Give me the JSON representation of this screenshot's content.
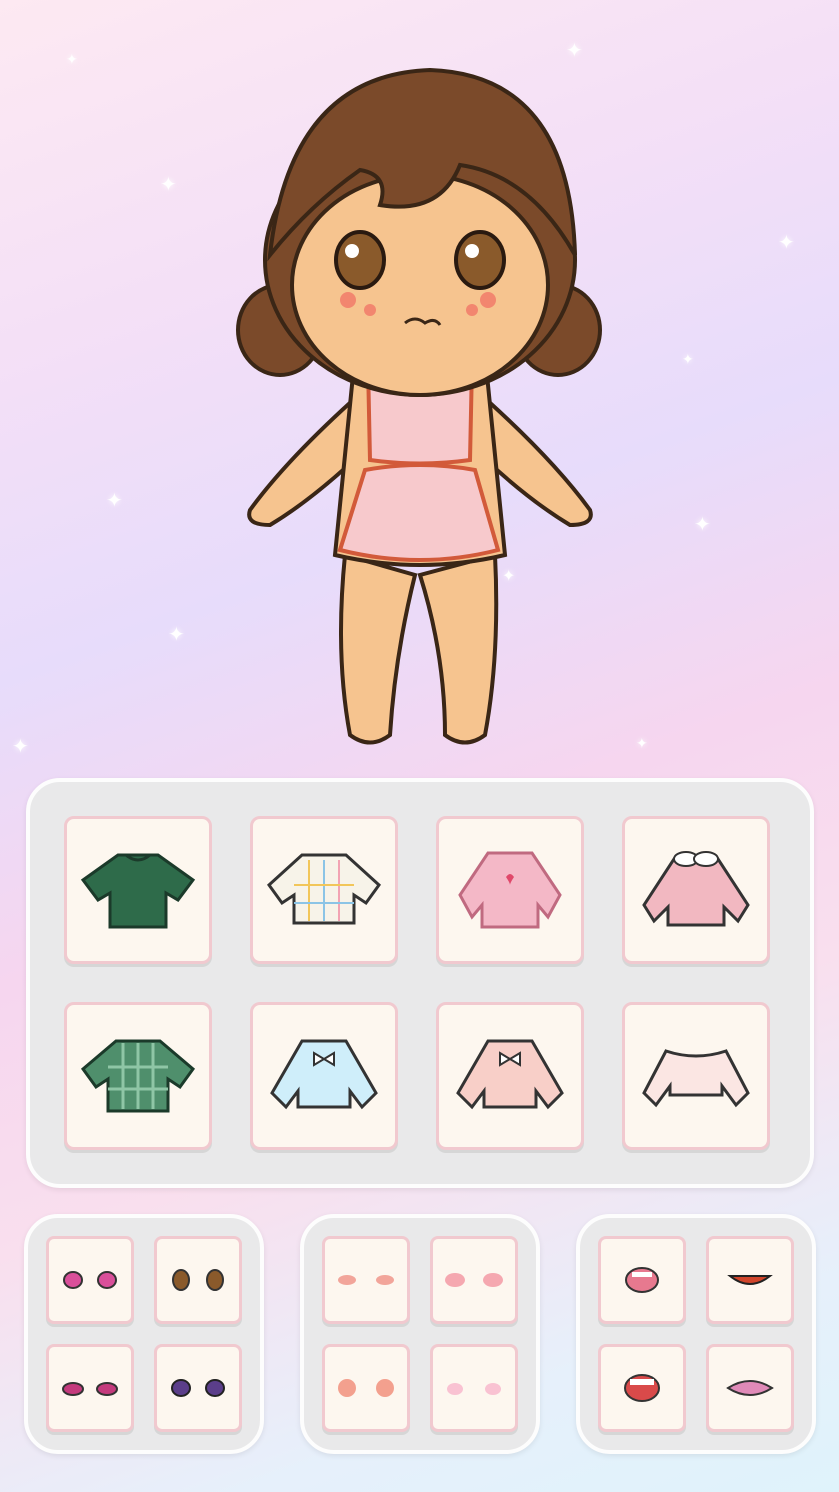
{
  "game": {
    "screen": "dress-up",
    "character": {
      "hair_color": "#7b4a2a",
      "skin_color": "#f6c48f",
      "outfit_color": "#f7c9cc",
      "outline_color": "#d25a3a"
    },
    "tops": [
      {
        "icon": "green-tshirt-icon",
        "color": "#2e6b4a"
      },
      {
        "icon": "plaid-white-top-icon",
        "color": "#f7f3e9"
      },
      {
        "icon": "pink-heart-sweater-icon",
        "color": "#f4b8c7"
      },
      {
        "icon": "pink-collar-sweater-icon",
        "color": "#f2b8c1"
      },
      {
        "icon": "green-plaid-top-icon",
        "color": "#4f8f6c"
      },
      {
        "icon": "blue-bow-top-icon",
        "color": "#cfeefa"
      },
      {
        "icon": "peach-bow-top-icon",
        "color": "#f8cfc8"
      },
      {
        "icon": "white-crop-top-icon",
        "color": "#fbe6e3"
      }
    ],
    "eyes": [
      {
        "icon": "pink-eyes-icon",
        "color": "#d94f9a"
      },
      {
        "icon": "brown-eyes-icon",
        "color": "#8a5a2b"
      },
      {
        "icon": "magenta-eyes-icon",
        "color": "#c43a7d"
      },
      {
        "icon": "purple-eyes-icon",
        "color": "#5b3e8a"
      }
    ],
    "blushes": [
      {
        "icon": "orange-blush-icon",
        "color": "#f2a59a"
      },
      {
        "icon": "pink-blush-icon",
        "color": "#f5a8b0"
      },
      {
        "icon": "round-blush-icon",
        "color": "#f3a08e"
      },
      {
        "icon": "light-pink-blush-icon",
        "color": "#f9c2d2"
      }
    ],
    "mouths": [
      {
        "icon": "pink-open-mouth-icon",
        "color": "#e7798f"
      },
      {
        "icon": "smile-mouth-icon",
        "color": "#d1452b"
      },
      {
        "icon": "red-open-mouth-icon",
        "color": "#d94a4a"
      },
      {
        "icon": "pink-lips-icon",
        "color": "#e08ab8"
      }
    ]
  }
}
